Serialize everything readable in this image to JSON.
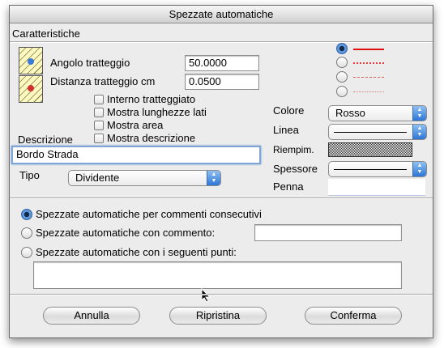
{
  "window": {
    "title": "Spezzate automatiche"
  },
  "section": {
    "title": "Caratteristiche"
  },
  "fields": {
    "angle_label": "Angolo tratteggio",
    "angle_value": "50.0000",
    "distance_label": "Distanza tratteggio cm",
    "distance_value": "0.0500"
  },
  "checkboxes": [
    {
      "label": "Interno tratteggiato",
      "checked": false
    },
    {
      "label": "Mostra lunghezze lati",
      "checked": false
    },
    {
      "label": "Mostra area",
      "checked": false
    },
    {
      "label": "Mostra descrizione",
      "checked": false
    }
  ],
  "description": {
    "label": "Descrizione",
    "value": "Bordo Strada"
  },
  "tipo": {
    "label": "Tipo",
    "value": "Dividente"
  },
  "line_styles": {
    "selected_index": 0,
    "colors": [
      "#e01010",
      "#e04040",
      "#e06060",
      "#e08080"
    ]
  },
  "right_panel": {
    "colore_label": "Colore",
    "colore_value": "Rosso",
    "linea_label": "Linea",
    "riempim_label": "Riempim.",
    "spessore_label": "Spessore",
    "penna_label": "Penna"
  },
  "options": [
    {
      "label": "Spezzate automatiche per commenti consecutivi",
      "selected": true
    },
    {
      "label": "Spezzate automatiche con commento:",
      "selected": false
    },
    {
      "label": "Spezzate automatiche con i seguenti punti:",
      "selected": false
    }
  ],
  "buttons": {
    "cancel": "Annulla",
    "reset": "Ripristina",
    "confirm": "Conferma"
  }
}
